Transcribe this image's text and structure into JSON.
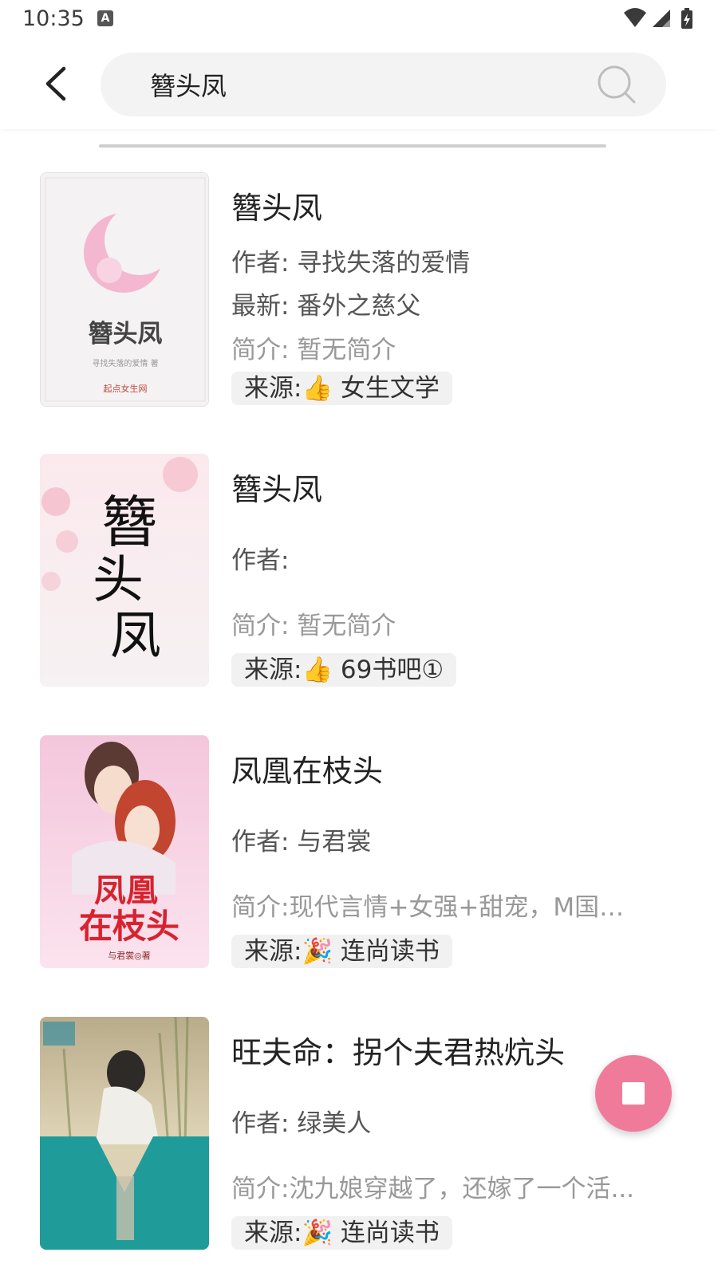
{
  "status_bar": {
    "time": "10:35",
    "app_icon": "A"
  },
  "toolbar": {
    "back_icon": "arrow-left-icon",
    "search_value": "簪头凤",
    "search_icon": "search-icon"
  },
  "results": [
    {
      "title": "簪头凤",
      "author": "作者: 寻找失落的爱情",
      "latest": "最新: 番外之慈父",
      "intro": "简介: 暂无简介",
      "source": "来源:👍 女生文学",
      "cover_text": "簪头凤",
      "cover_author": "寻找失落的爱情 著",
      "cover_publisher": "起点女生网"
    },
    {
      "title": "簪头凤",
      "author": "作者:",
      "latest": "",
      "intro": "简介: 暂无简介",
      "source": "来源:👍 69书吧①",
      "cover_text": "簪头凤"
    },
    {
      "title": "凤凰在枝头",
      "author": "作者: 与君裳",
      "latest": "",
      "intro": "简介:现代言情+女强+甜宠，M国的...",
      "source": "来源:🎉 连尚读书",
      "cover_text": "凤凰在枝头",
      "cover_author": "与君裳◎著"
    },
    {
      "title": "旺夫命：拐个夫君热炕头",
      "author": "作者: 绿美人",
      "latest": "",
      "intro": "简介:沈九娘穿越了，还嫁了一个活...",
      "source": "来源:🎉 连尚读书"
    }
  ],
  "fab": {
    "icon": "stop-icon",
    "color": "#f07a9a"
  }
}
